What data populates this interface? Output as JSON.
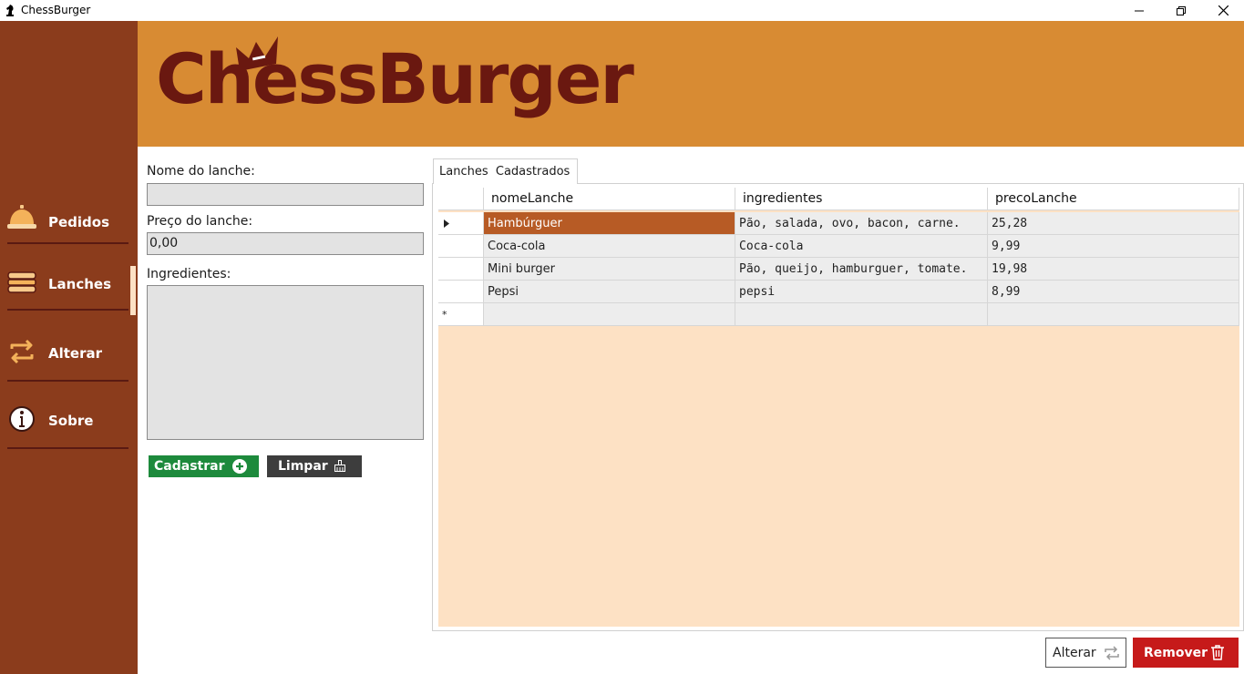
{
  "window": {
    "title": "ChessBurger"
  },
  "banner": {
    "logo_text": "ChessBurger"
  },
  "sidebar": {
    "items": [
      {
        "label": "Pedidos",
        "icon": "bell-icon"
      },
      {
        "label": "Lanches",
        "icon": "burger-icon",
        "active": true
      },
      {
        "label": "Alterar",
        "icon": "swap-icon"
      },
      {
        "label": "Sobre",
        "icon": "info-icon"
      }
    ]
  },
  "form": {
    "nome_label": "Nome do lanche:",
    "nome_value": "",
    "preco_label": "Preço do lanche:",
    "preco_value": "0,00",
    "ingredientes_label": "Ingredientes:",
    "ingredientes_value": "",
    "cadastrar_label": "Cadastrar",
    "limpar_label": "Limpar"
  },
  "tab": {
    "label": "Lanches  Cadastrados"
  },
  "table": {
    "columns": [
      "nomeLanche",
      "ingredientes",
      "precoLanche"
    ],
    "rows": [
      {
        "nomeLanche": "Hambúrguer",
        "ingredientes": "Pão, salada, ovo, bacon, carne.",
        "precoLanche": "25,28",
        "selected": true
      },
      {
        "nomeLanche": "Coca-cola",
        "ingredientes": "Coca-cola",
        "precoLanche": "9,99"
      },
      {
        "nomeLanche": "Mini burger",
        "ingredientes": "Pão, queijo, hamburguer, tomate.",
        "precoLanche": "19,98"
      },
      {
        "nomeLanche": "Pepsi",
        "ingredientes": "pepsi",
        "precoLanche": "8,99"
      }
    ],
    "new_row_marker": "*"
  },
  "actions": {
    "alterar_label": "Alterar",
    "remover_label": "Remover"
  },
  "colors": {
    "sidebar": "#8b3c1c",
    "banner": "#d88b33",
    "logo": "#6a1810",
    "grid_background": "#fde1c4",
    "selected_cell": "#b75b25",
    "cadastrar": "#1d8a3c",
    "limpar": "#3d3d3d",
    "remover": "#c61a1a"
  }
}
